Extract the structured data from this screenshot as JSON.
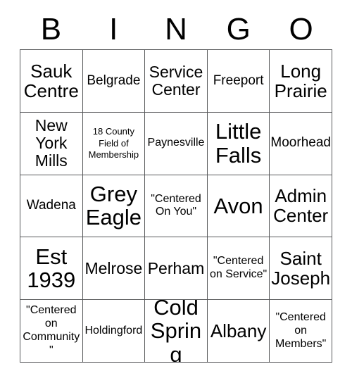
{
  "card": {
    "header_letters": [
      "B",
      "I",
      "N",
      "G",
      "O"
    ],
    "rows": [
      [
        {
          "text": "Sauk Centre",
          "size": "xl"
        },
        {
          "text": "Belgrade",
          "size": "md"
        },
        {
          "text": "Service Center",
          "size": "lg"
        },
        {
          "text": "Freeport",
          "size": "md"
        },
        {
          "text": "Long Prairie",
          "size": "xl"
        }
      ],
      [
        {
          "text": "New York Mills",
          "size": "lg"
        },
        {
          "text": "18 County Field of Membership",
          "size": "xs"
        },
        {
          "text": "Paynesville",
          "size": "sm"
        },
        {
          "text": "Little Falls",
          "size": "xxl"
        },
        {
          "text": "Moorhead",
          "size": "md"
        }
      ],
      [
        {
          "text": "Wadena",
          "size": "md"
        },
        {
          "text": "Grey Eagle",
          "size": "xxl"
        },
        {
          "text": "\"Centered On You\"",
          "size": "sm"
        },
        {
          "text": "Avon",
          "size": "xxl"
        },
        {
          "text": "Admin Center",
          "size": "xl"
        }
      ],
      [
        {
          "text": "Est 1939",
          "size": "xxl"
        },
        {
          "text": "Melrose",
          "size": "lg"
        },
        {
          "text": "Perham",
          "size": "lg"
        },
        {
          "text": "\"Centered on Service\"",
          "size": "sm"
        },
        {
          "text": "Saint Joseph",
          "size": "xl"
        }
      ],
      [
        {
          "text": "\"Centered on Community\"",
          "size": "sm"
        },
        {
          "text": "Holdingford",
          "size": "sm"
        },
        {
          "text": "Cold Spring",
          "size": "xxl"
        },
        {
          "text": "Albany",
          "size": "xl"
        },
        {
          "text": "\"Centered on Members\"",
          "size": "sm"
        }
      ]
    ]
  },
  "colors": {
    "grid_line": "#58595b",
    "text": "#000000",
    "background": "#ffffff"
  }
}
